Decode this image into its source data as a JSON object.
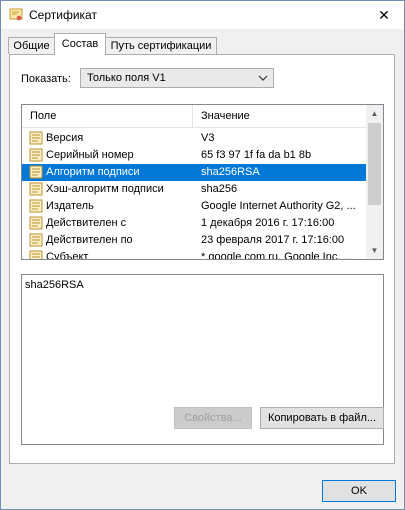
{
  "window": {
    "title": "Сертификат"
  },
  "tabs": [
    {
      "label": "Общие"
    },
    {
      "label": "Состав"
    },
    {
      "label": "Путь сертификации"
    }
  ],
  "show": {
    "label": "Показать:",
    "selected": "Только поля V1"
  },
  "list": {
    "headers": {
      "field": "Поле",
      "value": "Значение"
    },
    "rows": [
      {
        "field": "Версия",
        "value": "V3"
      },
      {
        "field": "Серийный номер",
        "value": "65 f3 97 1f fa da b1 8b"
      },
      {
        "field": "Алгоритм подписи",
        "value": "sha256RSA"
      },
      {
        "field": "Хэш-алгоритм подписи",
        "value": "sha256"
      },
      {
        "field": "Издатель",
        "value": "Google Internet Authority G2, ..."
      },
      {
        "field": "Действителен с",
        "value": "1 декабря 2016 г. 17:16:00"
      },
      {
        "field": "Действителен по",
        "value": "23 февраля 2017 г. 17:16:00"
      },
      {
        "field": "Субъект",
        "value": "*.google.com.ru, Google Inc, ..."
      }
    ],
    "selected_index": 2
  },
  "detail": {
    "text": "sha256RSA"
  },
  "buttons": {
    "properties": "Свойства...",
    "copy": "Копировать в файл...",
    "ok": "OK"
  },
  "colors": {
    "selection": "#0078d7",
    "window_bg": "#f0f0f0"
  }
}
